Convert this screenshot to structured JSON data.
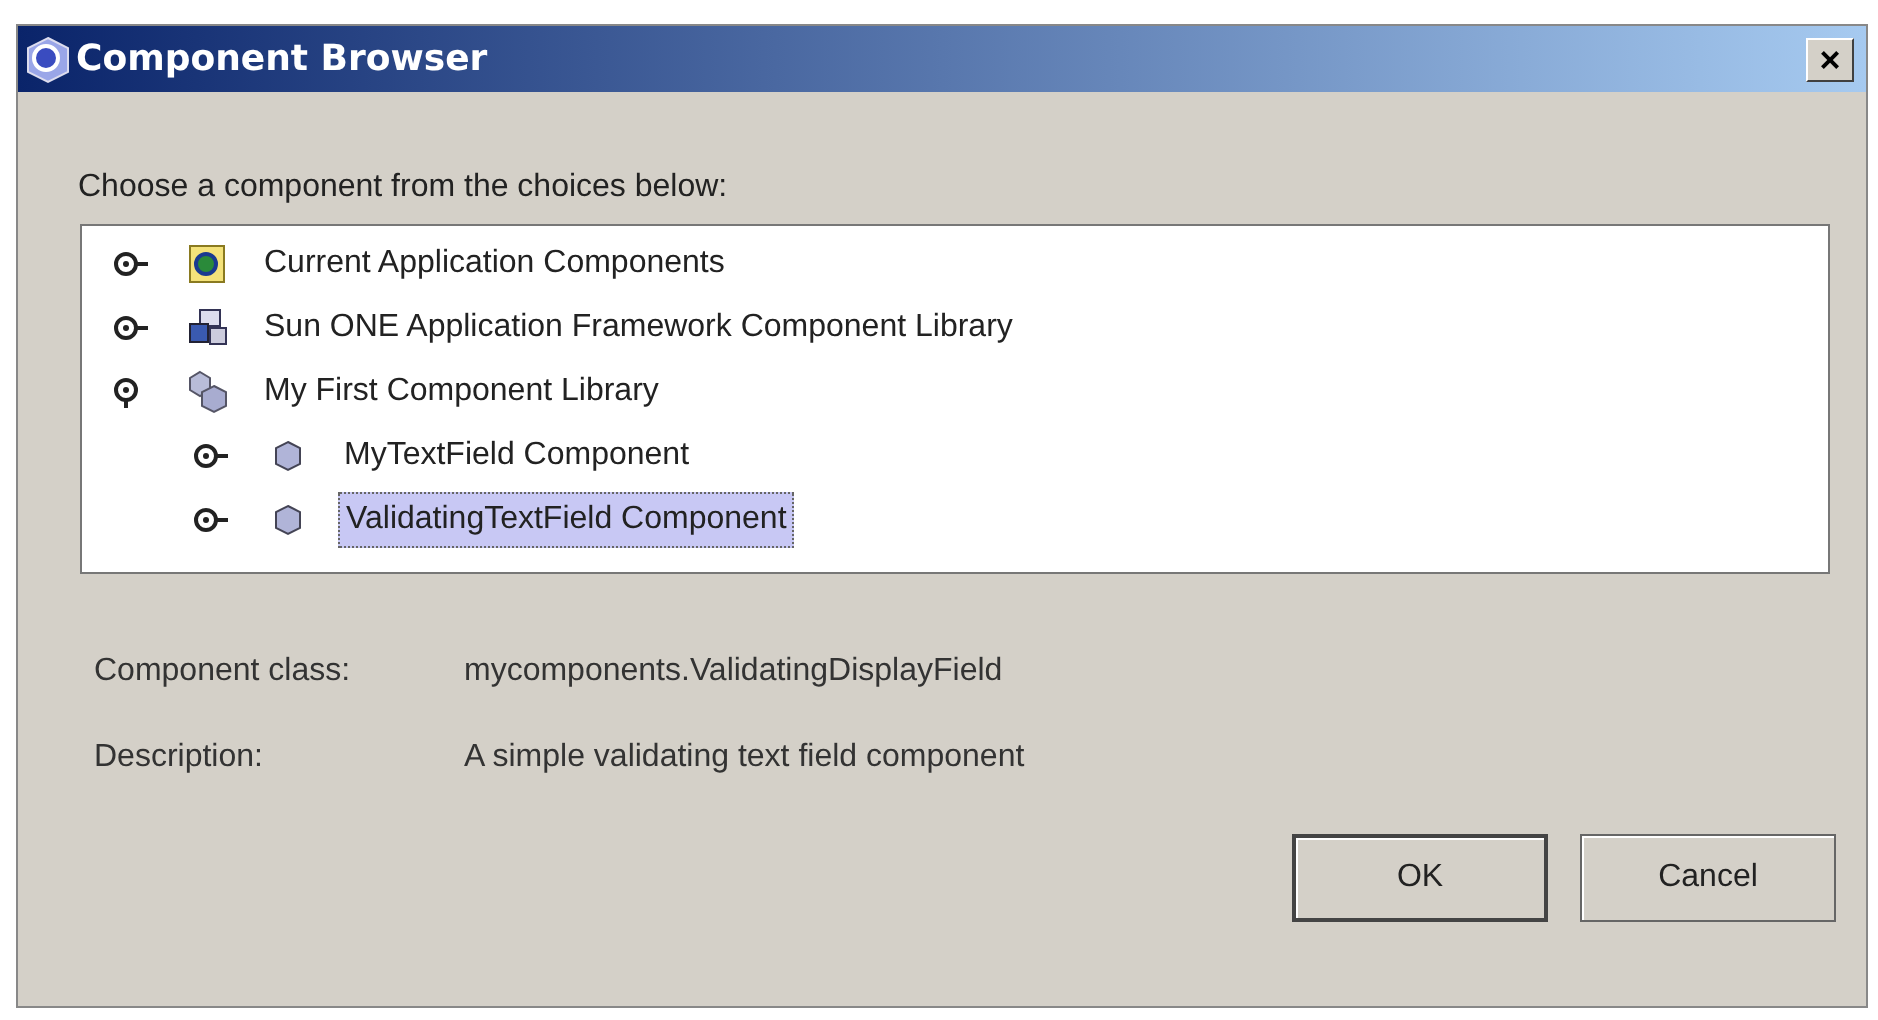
{
  "window": {
    "title": "Component Browser",
    "close": "×"
  },
  "prompt": "Choose a component from the choices below:",
  "tree": [
    {
      "label": "Current Application Components",
      "kind": "application",
      "expanded": false,
      "selected": false
    },
    {
      "label": "Sun ONE Application Framework Component Library",
      "kind": "framework",
      "expanded": false,
      "selected": false
    },
    {
      "label": "My First Component Library",
      "kind": "library",
      "expanded": true,
      "selected": false,
      "children": [
        {
          "label": "MyTextField Component",
          "kind": "component",
          "expanded": false,
          "selected": false
        },
        {
          "label": "ValidatingTextField Component",
          "kind": "component",
          "expanded": false,
          "selected": true
        }
      ]
    }
  ],
  "details": [
    {
      "label": "Component class:",
      "value": "mycomponents.ValidatingDisplayField"
    },
    {
      "label": "Description:",
      "value": "A simple validating text field component"
    }
  ],
  "buttons": [
    {
      "label": "OK",
      "default": true
    },
    {
      "label": "Cancel",
      "default": false
    }
  ]
}
